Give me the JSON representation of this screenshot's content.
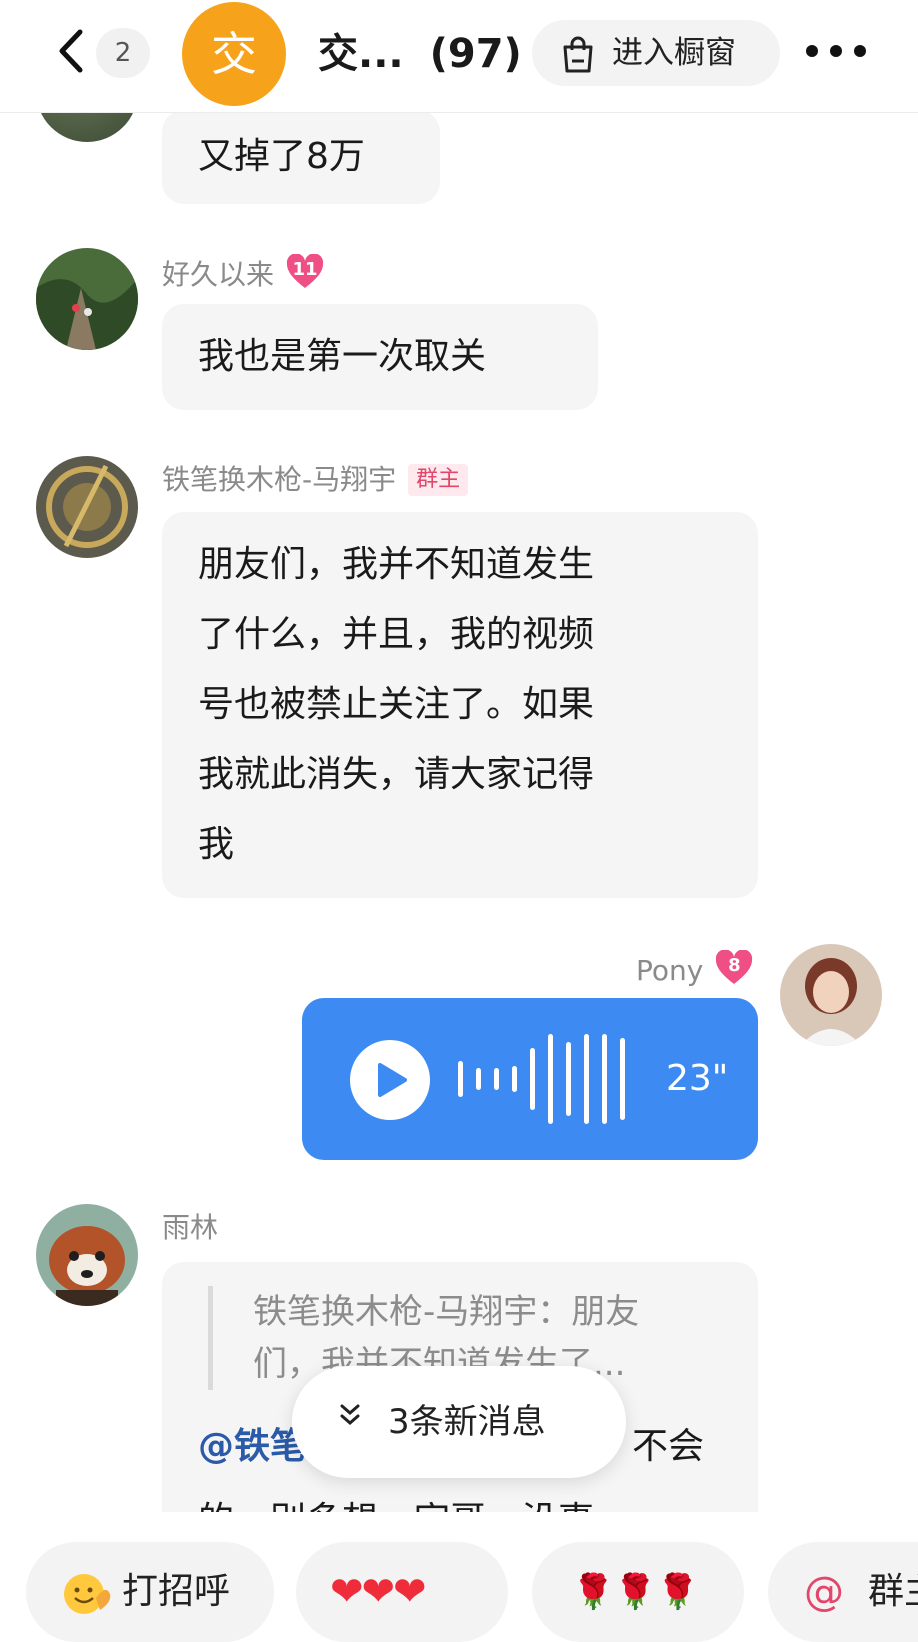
{
  "header": {
    "unread_count": "2",
    "group_avatar_char": "交",
    "group_name": "交...",
    "member_count": "(97)",
    "shop_label": "进入橱窗"
  },
  "messages": [
    {
      "text": "又掉了8万"
    },
    {
      "sender": "好久以来",
      "level": "11",
      "text": "我也是第一次取关"
    },
    {
      "sender": "铁笔换木枪-马翔宇",
      "tag": "群主",
      "lines": [
        "朋友们，我并不知道发生",
        "了什么，并且，我的视频",
        "号也被禁止关注了。如果",
        "我就此消失，请大家记得",
        "我"
      ]
    },
    {
      "sender": "Pony",
      "level": "8",
      "voice_duration": "23\""
    },
    {
      "sender": "雨林",
      "quote_lines": [
        "铁笔换木枪-马翔宇：朋友",
        "们，我并不知道发生了..."
      ],
      "mention": "@铁笔",
      "reply_tail": "不会",
      "reply_line2": "的，别多想，宇哥，没事"
    }
  ],
  "new_messages_label": "3条新消息",
  "quick_replies": [
    {
      "label": "打招呼"
    },
    {
      "label": "❤❤❤"
    },
    {
      "label": "🌹🌹🌹"
    },
    {
      "label": "群主"
    }
  ],
  "colors": {
    "accent_blue": "#3d8bf2",
    "group_avatar": "#f7a21b",
    "owner_tag": "#e2466b",
    "heart_badge": "#f04f86"
  },
  "icons": [
    "back-chevron-icon",
    "shop-bag-icon",
    "more-dots-icon",
    "play-icon",
    "chevron-down-icon",
    "wave-hand-icon",
    "at-icon"
  ]
}
